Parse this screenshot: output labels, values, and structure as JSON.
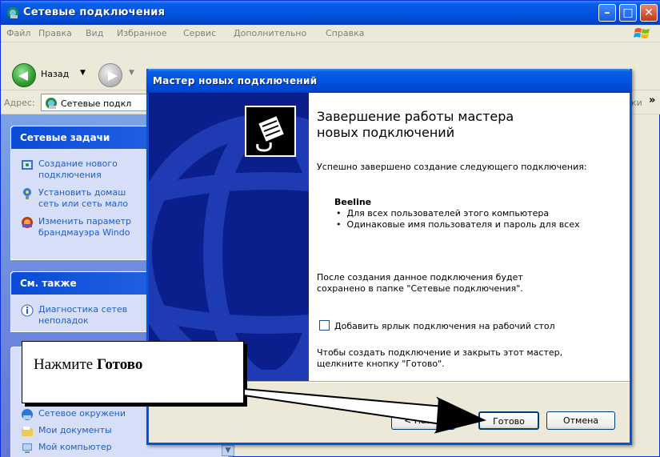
{
  "explorer": {
    "title": "Сетевые подключения",
    "menu": [
      "Файл",
      "Правка",
      "Вид",
      "Избранное",
      "Сервис",
      "Дополнительно",
      "Справка"
    ],
    "toolbar": {
      "back_label": "Назад"
    },
    "address": {
      "label": "Адрес:",
      "value": "Сетевые подкл",
      "right_fragment": "ки"
    },
    "left_panel": {
      "network_tasks": {
        "title": "Сетевые задачи",
        "items": [
          {
            "label_line1": "Создание нового",
            "label_line2": "подключения",
            "icon": "new-connection-icon"
          },
          {
            "label_line1": "Установить домаш",
            "label_line2": "сеть или сеть мало",
            "icon": "home-network-icon"
          },
          {
            "label_line1": "Изменить параметр",
            "label_line2": "брандмауэра Windo",
            "icon": "firewall-icon"
          }
        ]
      },
      "see_also": {
        "title": "См. также",
        "items": [
          {
            "label_line1": "Диагностика сетев",
            "label_line2": "неполадок",
            "icon": "info-icon"
          }
        ]
      },
      "other_places": {
        "items": [
          {
            "label": "Сетевое окружени",
            "icon": "network-places-icon"
          },
          {
            "label": "Мои документы",
            "icon": "my-documents-icon"
          },
          {
            "label": "Мой компьютер",
            "icon": "my-computer-icon"
          }
        ]
      }
    }
  },
  "wizard": {
    "title": "Мастер новых подключений",
    "heading_line1": "Завершение работы мастера",
    "heading_line2": "новых подключений",
    "intro": "Успешно завершено создание следующего подключения:",
    "connection_name": "Beeline",
    "bullets": [
      "Для всех пользователей этого компьютера",
      "Одинаковые имя пользователя и пароль для всех"
    ],
    "saved_note_line1": "После создания данное подключения будет",
    "saved_note_line2": "сохранено в папке \"Сетевые подключения\".",
    "checkbox_label": "Добавить ярлык подключения на рабочий стол",
    "checkbox_checked": false,
    "finish_note_line1": "Чтобы создать подключение и закрыть этот мастер,",
    "finish_note_line2": "щелкните кнопку \"Готово\".",
    "buttons": {
      "back": "< Назад",
      "finish": "Готово",
      "cancel": "Отмена"
    }
  },
  "callout": {
    "prefix": "Нажмите ",
    "bold": "Готово"
  },
  "colors": {
    "xp_blue": "#0054E3",
    "wizard_side": "#0A1F8C",
    "link_blue": "#215DC6"
  }
}
